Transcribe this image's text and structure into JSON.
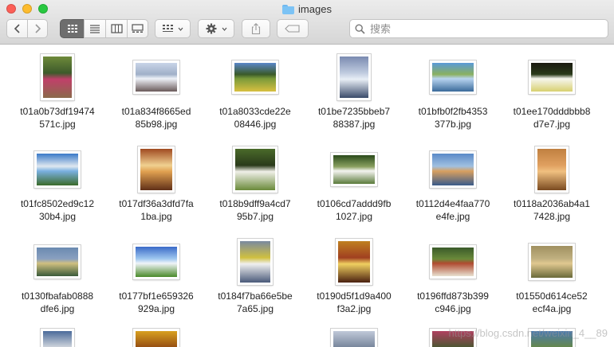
{
  "window": {
    "title": "images"
  },
  "toolbar": {
    "back_icon": "chevron-left",
    "forward_icon": "chevron-right",
    "view_modes": [
      "icon-view",
      "list-view",
      "column-view",
      "gallery-view"
    ],
    "active_view": "icon-view",
    "group_icon": "group-grid",
    "action_icon": "gear",
    "share_icon": "share",
    "tag_icon": "tag"
  },
  "search": {
    "placeholder": "搜索"
  },
  "files": [
    {
      "line1": "t01a0b73df19474",
      "line2": "571c.jpg",
      "img": "cottage-garden"
    },
    {
      "line1": "t01a834f8665ed",
      "line2": "85b98.jpg",
      "img": "snow-village"
    },
    {
      "line1": "t01a8033cde22e",
      "line2": "08446.jpg",
      "img": "flower-field"
    },
    {
      "line1": "t01be7235bbeb7",
      "line2": "88387.jpg",
      "img": "snowy-mountain"
    },
    {
      "line1": "t01bfb0f2fb4353",
      "line2": "377b.jpg",
      "img": "lake-mountains"
    },
    {
      "line1": "t01ee170dddbbb8",
      "line2": "d7e7.jpg",
      "img": "white-flowers"
    },
    {
      "line1": "t01fc8502ed9c12",
      "line2": "30b4.jpg",
      "img": "coast-hills"
    },
    {
      "line1": "t017df36a3dfd7fa",
      "line2": "1ba.jpg",
      "img": "window-interior"
    },
    {
      "line1": "t018b9dff9a4cd7",
      "line2": "95b7.jpg",
      "img": "white-cottage"
    },
    {
      "line1": "t0106cd7addd9fb",
      "line2": "1027.jpg",
      "img": "daisy-field"
    },
    {
      "line1": "t0112d4e4faa770",
      "line2": "e4fe.jpg",
      "img": "lake-town"
    },
    {
      "line1": "t0118a2036ab4a1",
      "line2": "7428.jpg",
      "img": "warm-hallway"
    },
    {
      "line1": "t0130fbafab0888",
      "line2": "dfe6.jpg",
      "img": "lake-sunset"
    },
    {
      "line1": "t0177bf1e659326",
      "line2": "929a.jpg",
      "img": "alpine-path"
    },
    {
      "line1": "t0184f7ba66e5be",
      "line2": "7a65.jpg",
      "img": "table-flowers"
    },
    {
      "line1": "t0190d5f1d9a400",
      "line2": "f3a2.jpg",
      "img": "cozy-room"
    },
    {
      "line1": "t0196ffd873b399",
      "line2": "c946.jpg",
      "img": "red-roof-cottage"
    },
    {
      "line1": "t01550d614ce52",
      "line2": "ecf4a.jpg",
      "img": "rolling-hills"
    }
  ],
  "colors": {
    "accent": "#6fb8f0"
  }
}
